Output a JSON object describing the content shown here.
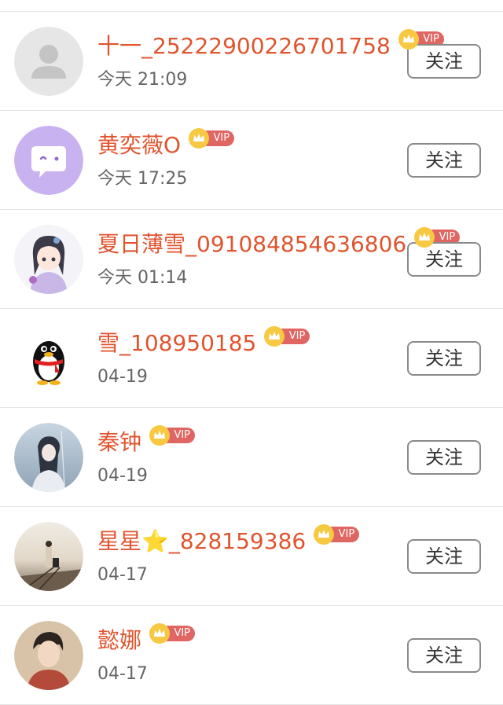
{
  "follow_label": "关注",
  "vip_label": "VIP",
  "colors": {
    "name": "#e0542e",
    "vip_tag": "#e06663",
    "crown": "#f7c942",
    "time": "#666666",
    "button_border": "#8a8a8a",
    "divider": "#e4e4e4"
  },
  "users": [
    {
      "name": "十一_2522290022670175​8",
      "time": "今天 21:09",
      "avatar": "default-avatar-icon"
    },
    {
      "name": "黄奕薇O",
      "time": "今天 17:25",
      "avatar": "chat-bubble-avatar"
    },
    {
      "name": "夏日薄雪_091084854636806",
      "time": "今天 01:14",
      "avatar": "anime-girl-avatar"
    },
    {
      "name": "雪_108950185",
      "time": "04-19",
      "avatar": "qq-penguin-avatar"
    },
    {
      "name": "秦钟",
      "time": "04-19",
      "avatar": "illustration-woman-avatar"
    },
    {
      "name": "星星⭐_828159386",
      "time": "04-17",
      "avatar": "railway-photo-avatar"
    },
    {
      "name": "懿娜",
      "time": "04-17",
      "avatar": "portrait-photo-avatar"
    }
  ]
}
